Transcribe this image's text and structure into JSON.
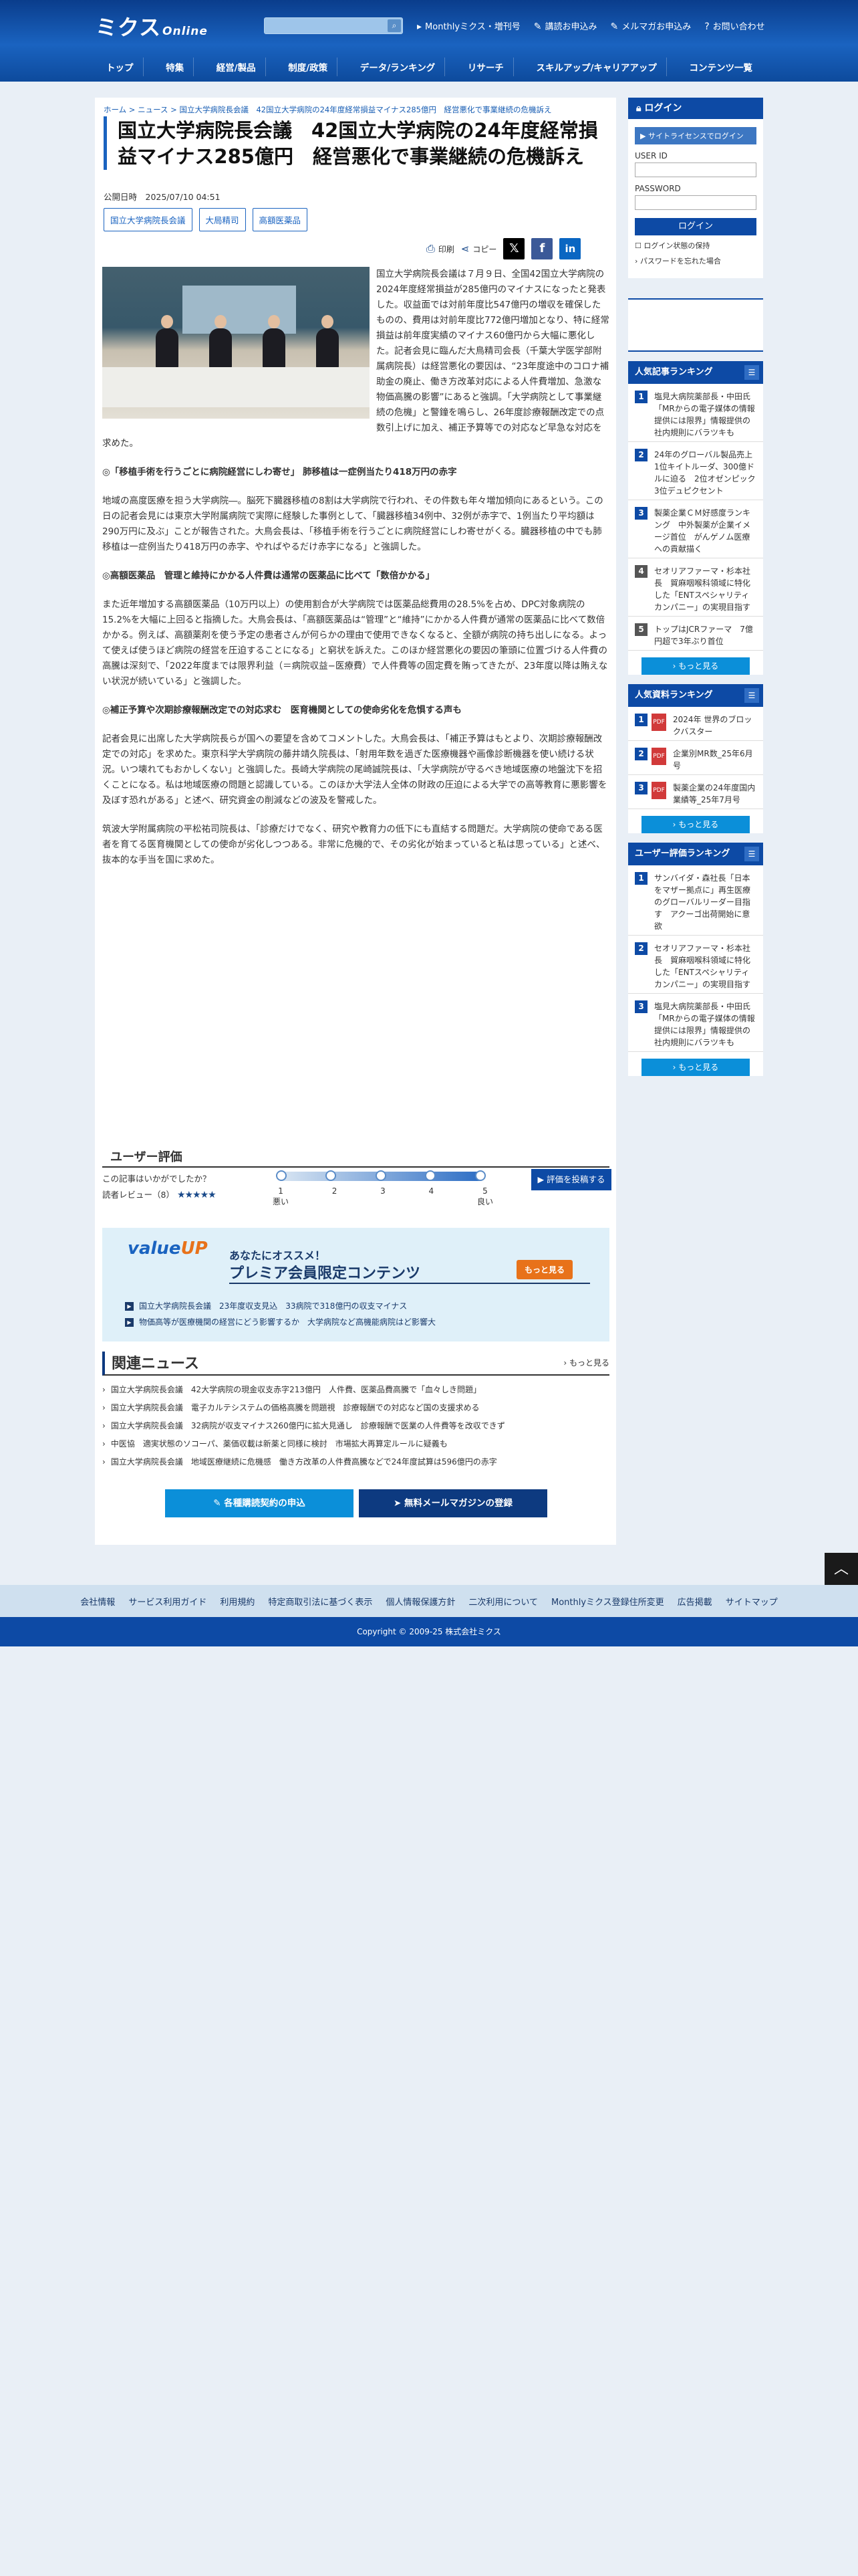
{
  "header": {
    "logo_main": "ミクス",
    "logo_sub": "Online",
    "top_links": [
      "Monthlyミクス・増刊号",
      "講読お申込み",
      "メルマガお申込み",
      "お問い合わせ"
    ],
    "nav": [
      "トップ",
      "特集",
      "経営/製品",
      "制度/政策",
      "データ/ランキング",
      "リサーチ",
      "スキルアップ/キャリアアップ",
      "コンテンツ一覧"
    ]
  },
  "breadcrumb": "ホーム > ニュース > 国立大学病院長会議　42国立大学病院の24年度経常損益マイナス285億円　経営悪化で事業継続の危機訴え",
  "article": {
    "title": "国立大学病院長会議　42国立大学病院の24年度経常損益マイナス285億円　経営悪化で事業継続の危機訴え",
    "pubdate": "公開日時　2025/07/10 04:51",
    "tags": [
      "国立大学病院長会議",
      "大局精司",
      "高額医薬品"
    ],
    "print_label": "印刷",
    "copy_label": "コピー",
    "p1": "国立大学病院長会議は７月９日、全国42国立大学病院の2024年度経常損益が285億円のマイナスになったと発表した。収益面では対前年度比547億円の増収を確保したものの、費用は対前年度比772億円増加となり、特に経常損益は前年度実績のマイナス60億円から大幅に悪化した。記者会見に臨んだ大鳥精司会長（千葉大学医学部附属病院長）は経営悪化の要因は、“23年度途中のコロナ補助金の廃止、働き方改革対応による人件費増加、急激な物価高騰の影響”にあると強調。「大学病院として事業継続の危機」と警鐘を鳴らし、26年度診療報酬改定での点数引上げに加え、補正予算等での対応など早急な対応を求めた。",
    "h1": "◎「移植手術を行うごとに病院経営にしわ寄せ」 肺移植は一症例当たり418万円の赤字",
    "p2": "地域の高度医療を担う大学病院―。脳死下臓器移植の8割は大学病院で行われ、その件数も年々増加傾向にあるという。この日の記者会見には東京大学附属病院で実際に経験した事例として、「臓器移植34例中、32例が赤字で、1例当たり平均額は290万円に及ぶ」ことが報告された。大鳥会長は、「移植手術を行うごとに病院経営にしわ寄せがくる。臓器移植の中でも肺移植は一症例当たり418万円の赤字、やればやるだけ赤字になる」と強調した。",
    "h2": "◎高額医薬品　管理と維持にかかる人件費は通常の医薬品に比べて「数倍かかる」",
    "p3": "また近年増加する高額医薬品（10万円以上）の使用割合が大学病院では医薬品総費用の28.5%を占め、DPC対象病院の15.2%を大幅に上回ると指摘した。大鳥会長は、「高額医薬品は“管理”と“維持”にかかる人件費が通常の医薬品に比べて数倍かかる。例えば、高額薬剤を使う予定の患者さんが何らかの理由で使用できなくなると、全額が病院の持ち出しになる。よって使えば使うほど病院の経営を圧迫することになる」と窮状を訴えた。このほか経営悪化の要因の筆頭に位置づける人件費の高騰は深刻で、「2022年度までは限界利益（＝病院収益−医療費）で人件費等の固定費を賄ってきたが、23年度以降は賄えない状況が続いている」と強調した。",
    "h3": "◎補正予算や次期診療報酬改定での対応求む　医育機関としての使命劣化を危惧する声も",
    "p4": "記者会見に出席した大学病院長らが国への要望を含めてコメントした。大鳥会長は、「補正予算はもとより、次期診療報酬改定での対応」を求めた。東京科学大学病院の藤井靖久院長は、「射用年数を過ぎた医療機器や画像診断機器を使い続ける状況。いつ壊れてもおかしくない」と強調した。長崎大学病院の尾崎誠院長は、「大学病院が守るべき地域医療の地盤沈下を招くことになる。私は地域医療の問題と認識している。このほか大学法人全体の財政の圧迫による大学での高等教育に悪影響を及ぼす恐れがある」と述べ、研究資金の削減などの波及を警戒した。",
    "p5": "筑波大学附属病院の平松祐司院長は、「診療だけでなく、研究や教育力の低下にも直結する問題だ。大学病院の使命である医者を育てる医育機関としての使命が劣化しつつある。非常に危機的で、その劣化が始まっていると私は思っている」と述べ、抜本的な手当を国に求めた。"
  },
  "evaluation": {
    "title": "ユーザー評価",
    "question": "この記事はいかがでしたか？",
    "review_label": "読者レビュー（8）",
    "stars": "★★★★★",
    "scale_numbers": [
      "1",
      "2",
      "3",
      "4",
      "5"
    ],
    "low_label": "悪い",
    "high_label": "良い",
    "post_button": "評価を投稿する",
    "rating": 4.4
  },
  "valueup": {
    "logo_value": "value",
    "logo_up": "UP",
    "line1": "あなたにオススメ！",
    "line2": "プレミア会員限定コンテンツ",
    "more": "もっと見る",
    "items": [
      "国立大学病院長会議　23年度収支見込　33病院で318億円の収支マイナス",
      "物価高等が医療機関の経営にどう影響するか　大学病院など高機能病院はど影響大"
    ]
  },
  "related": {
    "title": "関連ニュース",
    "more": "もっと見る",
    "items": [
      "国立大学病院長会議　42大学病院の現金収支赤字213億円　人件費、医薬品費高騰で「血々しき問題」",
      "国立大学病院長会議　電子カルテシステムの価格高騰を問題視　診療報酬での対応など国の支援求める",
      "国立大学病院長会議　32病院が収支マイナス260億円に拡大見通し　診療報酬で医業の人件費等を改収できず",
      "中医協　適実状態のソコーパ、薬価収載は新薬と同様に検討　市場拡大再算定ルールに疑義も",
      "国立大学病院長会議　地域医療継続に危機感　働き方改革の人件費高騰などで24年度試算は596億円の赤字"
    ]
  },
  "cta": {
    "contract": "各種購読契約の申込",
    "mail": "無料メールマガジンの登録"
  },
  "sidebar": {
    "login": {
      "title": "ログイン",
      "site_license": "サイトライセンスでログイン",
      "userid_label": "USER ID",
      "password_label": "PASSWORD",
      "button": "ログイン",
      "keep": "ログイン状態の保持",
      "forgot": "パスワードを忘れた場合"
    },
    "popular": {
      "title": "人気記事ランキング",
      "items": [
        "塩見大病院薬部長・中田氏「MRからの電子媒体の情報提供には限界」情報提供の社内規則にバラツキも",
        "24年のグローバル製品売上　1位キイトルーダ、300億ドルに迫る　2位オゼンピック 3位デュピクセント",
        "製薬企業ＣＭ好感度ランキング　中外製薬が企業イメージ首位　がんゲノム医療への貢献描く",
        "セオリアファーマ・杉本社長　貿麻咽喉科領域に特化した「ENTスペシャリティカンパニー」の実現目指す",
        "トップはJCRファーマ　7億円超で3年ぶり首位"
      ],
      "more": "もっと見る"
    },
    "data_rank": {
      "title": "人気資料ランキング",
      "items": [
        "2024年 世界のブロックバスター",
        "企業別MR数_25年6月号",
        "製薬企業の24年度国内業績等_25年7月号"
      ],
      "more": "もっと見る"
    },
    "user_rank": {
      "title": "ユーザー評価ランキング",
      "items": [
        "サンバイダ・森社長「日本をマザー拠点に」再生医療のグローバルリーダー目指す　アクーゴ出荷開始に意欲",
        "セオリアファーマ・杉本社長　貿麻咽喉科領域に特化した「ENTスペシャリティカンパニー」の実現目指す",
        "塩見大病院薬部長・中田氏「MRからの電子媒体の情報提供には限界」情報提供の社内規則にバラツキも"
      ],
      "more": "もっと見る"
    }
  },
  "footer": {
    "links": [
      "会社情報",
      "サービス利用ガイド",
      "利用規約",
      "特定商取引法に基づく表示",
      "個人情報保護方針",
      "二次利用について",
      "Monthlyミクス登録住所変更",
      "広告掲載",
      "サイトマップ"
    ],
    "copyright": "Copyright © 2009-25 株式会社ミクス"
  },
  "colors": {
    "brand": "#0d4aa5",
    "accent": "#e8721a",
    "cta_light": "#0b8fd9"
  }
}
